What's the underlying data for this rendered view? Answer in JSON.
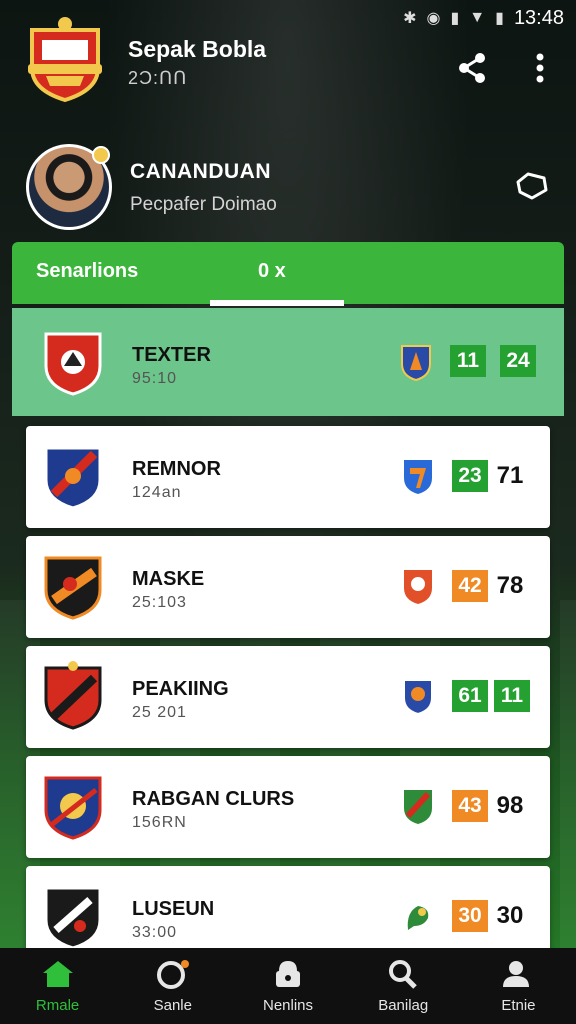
{
  "status_bar": {
    "time": "13:48",
    "icons": [
      "bluetooth-icon",
      "wifi-icon",
      "signal-icon",
      "wifi-strength-icon",
      "battery-icon"
    ]
  },
  "header": {
    "title": "Sepak Bobla",
    "subtitle": "2Ͻ:ՈՈ",
    "actions": [
      "share-icon",
      "more-vert-icon"
    ]
  },
  "profile": {
    "name": "CANANDUAN",
    "subtitle": "Pecpafer Doimao",
    "action_icon": "shield-outline-icon"
  },
  "tabs": {
    "label": "Senarlions",
    "close_label": "0 x"
  },
  "colors": {
    "accent_green": "#3bb53b",
    "active_row": "#6cc58a",
    "score_green": "#25a131",
    "score_orange": "#f08a24"
  },
  "teams": [
    {
      "name": "TEXTER",
      "sub": "95:10",
      "score1": "11",
      "score1_color": "#25a131",
      "score2": "24",
      "score2_boxed": true,
      "active": true,
      "crest": "red-crest",
      "opp_crest": "blue-shield-crest"
    },
    {
      "name": "REMNOR",
      "sub": "124an",
      "score1": "23",
      "score1_color": "#25a131",
      "score2": "71",
      "score2_boxed": false,
      "active": false,
      "crest": "blue-red-crest",
      "opp_crest": "blue-orange-shield-crest"
    },
    {
      "name": "MASKE",
      "sub": "25:103",
      "score1": "42",
      "score1_color": "#f08a24",
      "score2": "78",
      "score2_boxed": false,
      "active": false,
      "crest": "black-orange-crest",
      "opp_crest": "red-dragon-crest"
    },
    {
      "name": "PEAKIING",
      "sub": "25 201",
      "score1": "61",
      "score1_color": "#25a131",
      "score2": "11",
      "score2_boxed": true,
      "active": false,
      "crest": "red-black-crest",
      "opp_crest": "blue-shield-crest"
    },
    {
      "name": "RABGAN CLURS",
      "sub": "156RN",
      "score1": "43",
      "score1_color": "#f08a24",
      "score2": "98",
      "score2_boxed": false,
      "active": false,
      "crest": "blue-gold-crest",
      "opp_crest": "green-red-shield-crest"
    },
    {
      "name": "LUSEUN",
      "sub": "33:00",
      "score1": "30",
      "score1_color": "#f08a24",
      "score2": "30",
      "score2_boxed": false,
      "active": false,
      "crest": "black-white-crest",
      "opp_crest": "green-dragon-crest"
    }
  ],
  "nav": [
    {
      "label": "Rmale",
      "icon": "home-icon",
      "active": true
    },
    {
      "label": "Sanle",
      "icon": "ball-icon",
      "active": false
    },
    {
      "label": "Nenlins",
      "icon": "lock-icon",
      "active": false
    },
    {
      "label": "Banilag",
      "icon": "search-icon",
      "active": false
    },
    {
      "label": "Etnie",
      "icon": "profile-icon",
      "active": false
    }
  ]
}
